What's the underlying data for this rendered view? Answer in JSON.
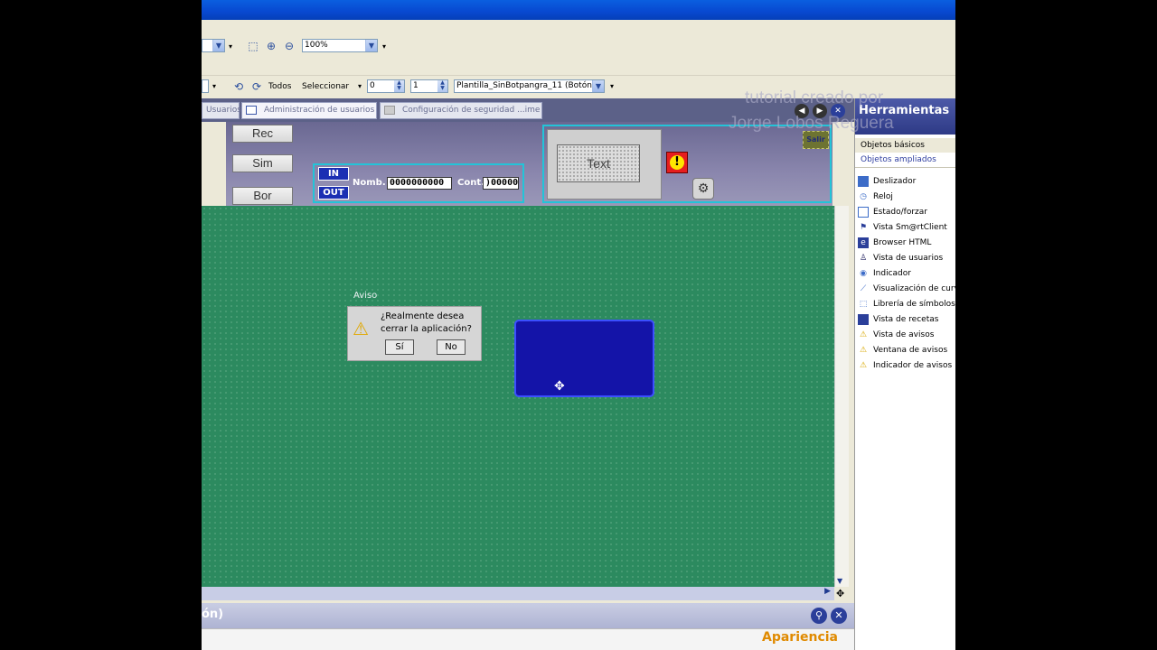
{
  "toolbar1": {
    "zoom_value": "100%"
  },
  "toolbar2": {
    "todos_label": "Todos",
    "seleccionar_label": "Seleccionar",
    "spin1_value": "0",
    "spin2_value": "1",
    "template_select": "Plantilla_SinBotpangra_11  (Botón)"
  },
  "tabs": [
    {
      "label": "Usuarios"
    },
    {
      "label": "Administración de usuarios"
    },
    {
      "label": "Configuración de seguridad ...ime"
    }
  ],
  "hmi": {
    "buttons": [
      "Rec",
      "Sim",
      "Bor"
    ],
    "in_label": "IN",
    "out_label": "OUT",
    "nomb_label": "Nomb.",
    "nomb_value": "0000000000",
    "cont_label": "Cont.",
    "cont_value": ")00000(",
    "text_label": "Text",
    "salir_label": "Salir"
  },
  "canvas": {
    "aviso_title": "Aviso",
    "aviso_message_line1": "¿Realmente desea",
    "aviso_message_line2": "cerrar la aplicación?",
    "yes_label": "Sí",
    "no_label": "No"
  },
  "properties": {
    "title": "ón)",
    "tab_label": "Apariencia"
  },
  "tools": {
    "title": "Herramientas",
    "category_basic": "Objetos básicos",
    "category_extended": "Objetos ampliados",
    "items": [
      {
        "label": "Deslizador",
        "icon": "slider-icon"
      },
      {
        "label": "Reloj",
        "icon": "clock-icon"
      },
      {
        "label": "Estado/forzar",
        "icon": "status-force-icon"
      },
      {
        "label": "Vista Sm@rtClient",
        "icon": "smartclient-icon"
      },
      {
        "label": "Browser HTML",
        "icon": "browser-icon"
      },
      {
        "label": "Vista de usuarios",
        "icon": "user-icon"
      },
      {
        "label": "Indicador",
        "icon": "indicator-icon"
      },
      {
        "label": "Visualización de curv",
        "icon": "trend-icon"
      },
      {
        "label": "Librería de símbolos",
        "icon": "symbol-library-icon"
      },
      {
        "label": "Vista de recetas",
        "icon": "recipe-icon"
      },
      {
        "label": "Vista de avisos",
        "icon": "alarm-view-icon"
      },
      {
        "label": "Ventana de avisos",
        "icon": "alarm-window-icon"
      },
      {
        "label": "Indicador de avisos",
        "icon": "alarm-indicator-icon"
      }
    ]
  },
  "watermark": {
    "line1": "tutorial creado por",
    "line2": "Jorge Lobos Reguera"
  }
}
